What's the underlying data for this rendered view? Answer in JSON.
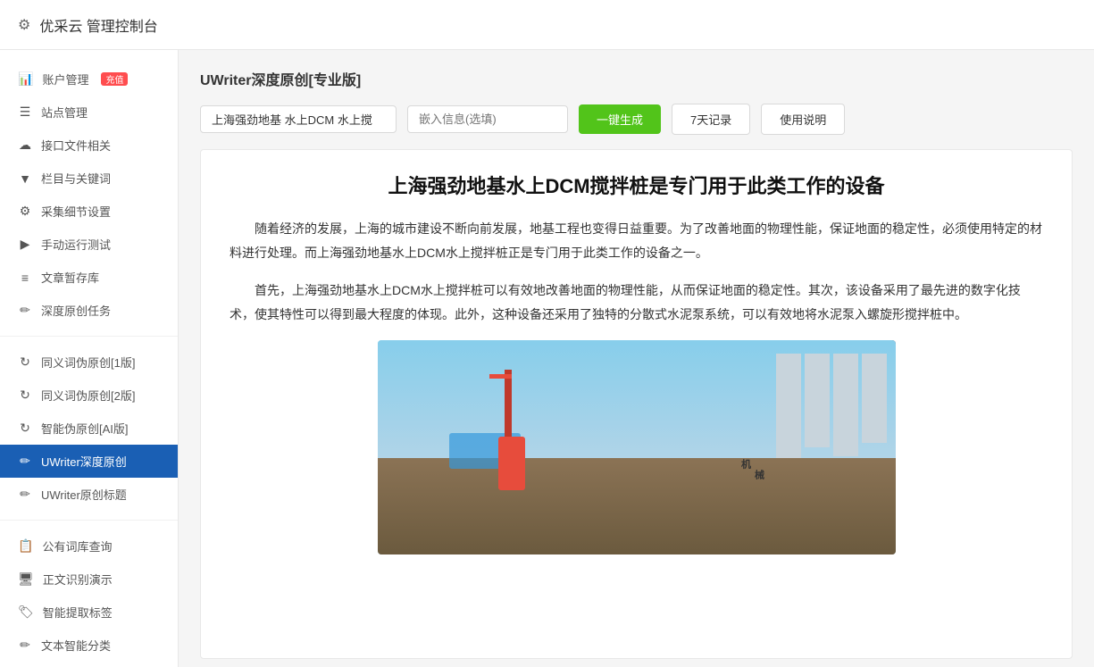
{
  "header": {
    "icon": "⚙",
    "title": "优采云 管理控制台"
  },
  "sidebar": {
    "sections": [
      {
        "items": [
          {
            "id": "account",
            "icon": "📊",
            "label": "账户管理",
            "badge": "充值",
            "active": false
          },
          {
            "id": "site",
            "icon": "☰",
            "label": "站点管理",
            "badge": "",
            "active": false
          },
          {
            "id": "interface",
            "icon": "☁",
            "label": "接口文件相关",
            "badge": "",
            "active": false
          },
          {
            "id": "columns",
            "icon": "▼",
            "label": "栏目与关键词",
            "badge": "",
            "active": false
          },
          {
            "id": "collect",
            "icon": "⚙",
            "label": "采集细节设置",
            "badge": "",
            "active": false
          },
          {
            "id": "manual",
            "icon": "▶",
            "label": "手动运行测试",
            "badge": "",
            "active": false
          },
          {
            "id": "archive",
            "icon": "≡",
            "label": "文章暂存库",
            "badge": "",
            "active": false
          },
          {
            "id": "deep-task",
            "icon": "✏",
            "label": "深度原创任务",
            "badge": "",
            "active": false
          }
        ]
      },
      {
        "items": [
          {
            "id": "pseudo1",
            "icon": "↻",
            "label": "同义词伪原创[1版]",
            "badge": "",
            "active": false
          },
          {
            "id": "pseudo2",
            "icon": "↻",
            "label": "同义词伪原创[2版]",
            "badge": "",
            "active": false
          },
          {
            "id": "ai-pseudo",
            "icon": "↻",
            "label": "智能伪原创[AI版]",
            "badge": "",
            "active": false
          },
          {
            "id": "uwriter",
            "icon": "✏",
            "label": "UWriter深度原创",
            "badge": "",
            "active": true
          },
          {
            "id": "uwriter-title",
            "icon": "✏",
            "label": "UWriter原创标题",
            "badge": "",
            "active": false
          }
        ]
      },
      {
        "items": [
          {
            "id": "phrase",
            "icon": "📋",
            "label": "公有词库查询",
            "badge": "",
            "active": false
          },
          {
            "id": "recog",
            "icon": "🖥",
            "label": "正文识别演示",
            "badge": "",
            "active": false
          },
          {
            "id": "tags",
            "icon": "🏷",
            "label": "智能提取标签",
            "badge": "",
            "active": false
          },
          {
            "id": "classify",
            "icon": "✏",
            "label": "文本智能分类",
            "badge": "",
            "active": false
          }
        ]
      }
    ]
  },
  "main": {
    "page_title": "UWriter深度原创[专业版]",
    "toolbar": {
      "keywords_value": "上海强劲地基 水上DCM 水上搅",
      "keywords_placeholder": "上海强劲地基 水上DCM 水上搅",
      "embed_placeholder": "嵌入信息(选填)",
      "btn_generate": "一键生成",
      "btn_history": "7天记录",
      "btn_help": "使用说明"
    },
    "article": {
      "title": "上海强劲地基水上DCM搅拌桩是专门用于此类工作的设备",
      "para1": "随着经济的发展，上海的城市建设不断向前发展，地基工程也变得日益重要。为了改善地面的物理性能，保证地面的稳定性，必须使用特定的材料进行处理。而上海强劲地基水上DCM水上搅拌桩正是专门用于此类工作的设备之一。",
      "para2": "首先，上海强劲地基水上DCM水上搅拌桩可以有效地改善地面的物理性能，从而保证地面的稳定性。其次，该设备采用了最先进的数字化技术，使其特性可以得到最大程度的体现。此外，这种设备还采用了独特的分散式水泥泵系统，可以有效地将水泥泵入螺旋形搅拌桩中。"
    }
  }
}
